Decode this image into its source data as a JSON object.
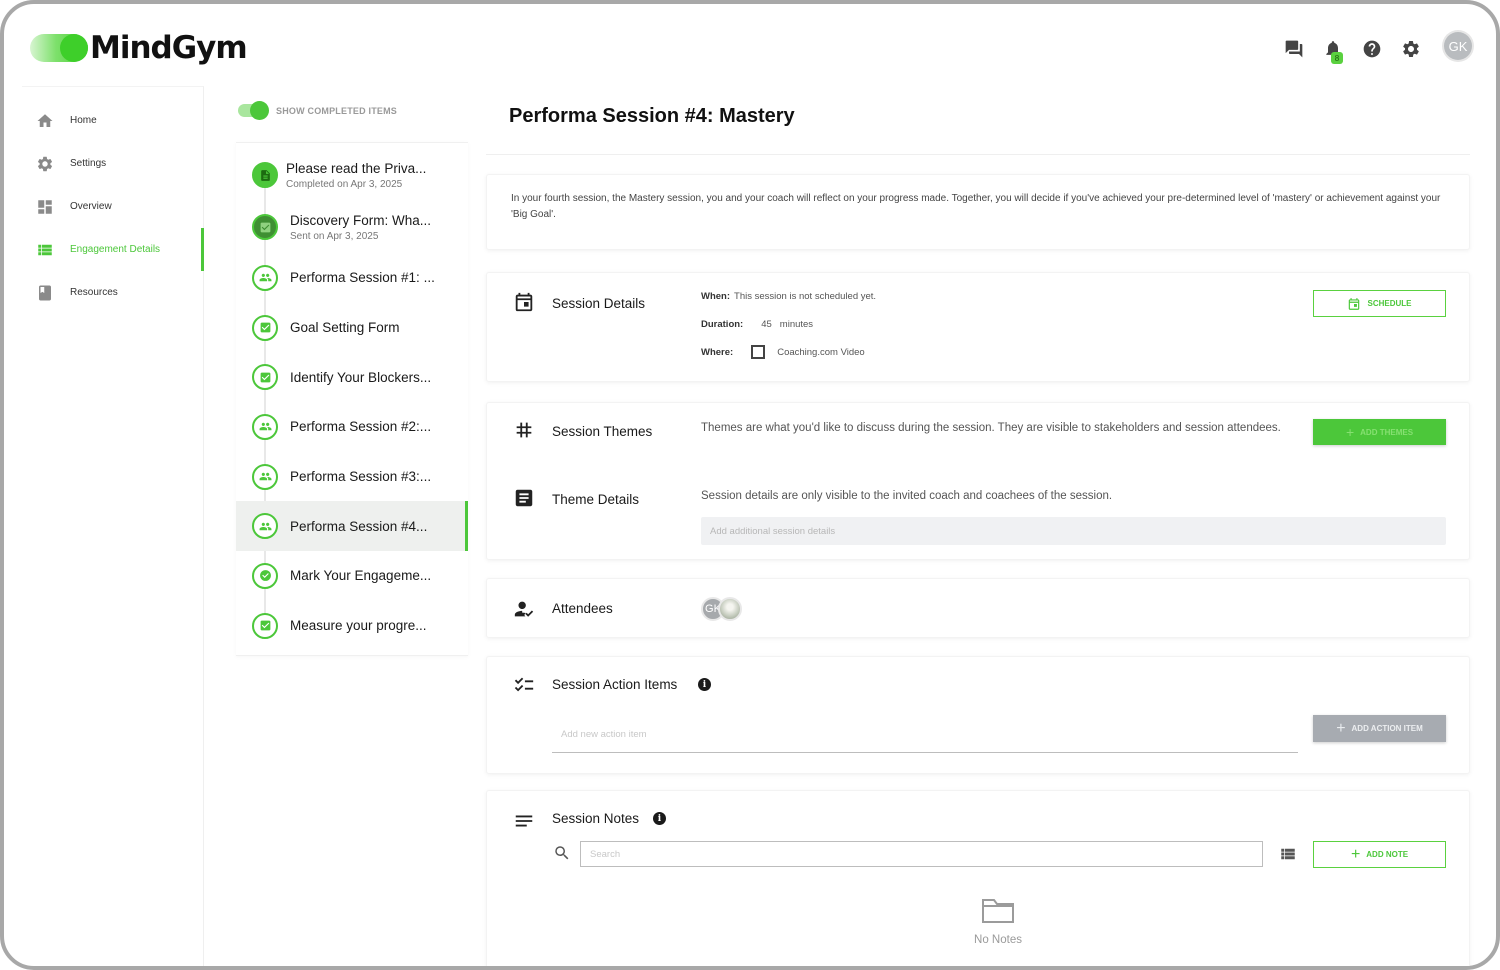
{
  "app": {
    "logo_text": "MindGym",
    "avatar_initials": "GK",
    "notification_count": "8"
  },
  "header_icons": [
    "chat-icon",
    "bell-icon",
    "help-icon",
    "gear-icon"
  ],
  "nav": {
    "items": [
      {
        "label": "Home",
        "icon": "home-icon"
      },
      {
        "label": "Settings",
        "icon": "gear-icon"
      },
      {
        "label": "Overview",
        "icon": "dashboard-icon"
      },
      {
        "label": "Engagement Details",
        "icon": "list-icon",
        "active": true
      },
      {
        "label": "Resources",
        "icon": "book-icon"
      }
    ]
  },
  "steps_panel": {
    "toggle_label": "SHOW COMPLETED ITEMS",
    "toggle_on": true,
    "steps": [
      {
        "title": "Please read the Priva...",
        "subtitle": "Completed on Apr 3, 2025",
        "icon": "document-icon",
        "state": "done"
      },
      {
        "title": "Discovery Form: Wha...",
        "subtitle": "Sent on Apr 3, 2025",
        "icon": "checkbox-icon",
        "state": "sent"
      },
      {
        "title": "Performa Session #1: ...",
        "subtitle": "",
        "icon": "group-icon",
        "state": "todo"
      },
      {
        "title": "Goal Setting Form",
        "subtitle": "",
        "icon": "checkbox-icon",
        "state": "todo"
      },
      {
        "title": "Identify Your Blockers...",
        "subtitle": "",
        "icon": "checkbox-icon",
        "state": "todo"
      },
      {
        "title": "Performa Session #2:...",
        "subtitle": "",
        "icon": "group-icon",
        "state": "todo"
      },
      {
        "title": "Performa Session #3:...",
        "subtitle": "",
        "icon": "group-icon",
        "state": "todo"
      },
      {
        "title": "Performa Session #4...",
        "subtitle": "",
        "icon": "group-icon",
        "state": "active"
      },
      {
        "title": "Mark Your Engageme...",
        "subtitle": "",
        "icon": "badge-icon",
        "state": "todo"
      },
      {
        "title": "Measure your progre...",
        "subtitle": "",
        "icon": "checkbox-icon",
        "state": "todo"
      }
    ]
  },
  "main": {
    "title": "Performa Session #4: Mastery",
    "description": "In your fourth session, the Mastery session, you and your coach will reflect on your progress made. Together, you will decide if you've achieved your pre-determined level of 'mastery' or achievement against your 'Big Goal'.",
    "session_details": {
      "label": "Session Details",
      "when_label": "When:",
      "when_value": "This session is not scheduled yet.",
      "duration_label": "Duration:",
      "duration_value": "45",
      "duration_unit": "minutes",
      "where_label": "Where:",
      "where_value": "Coaching.com Video",
      "schedule_button": "SCHEDULE"
    },
    "session_themes": {
      "label": "Session Themes",
      "text": "Themes are what you'd like to discuss during the session. They are visible to stakeholders and session attendees.",
      "add_button": "ADD THEMES"
    },
    "theme_details": {
      "label": "Theme Details",
      "text": "Session details are only visible to the invited coach and coachees of the session.",
      "placeholder": "Add additional session details"
    },
    "attendees": {
      "label": "Attendees",
      "initials": "GK"
    },
    "action_items": {
      "label": "Session Action Items",
      "placeholder": "Add new action item",
      "add_button": "ADD ACTION ITEM"
    },
    "notes": {
      "label": "Session Notes",
      "search_placeholder": "Search",
      "add_button": "ADD NOTE",
      "empty_text": "No Notes"
    }
  },
  "colors": {
    "accent": "#4cc73a",
    "text": "#1a1a1a",
    "muted": "#777777",
    "grey_button": "#a7abb1"
  }
}
